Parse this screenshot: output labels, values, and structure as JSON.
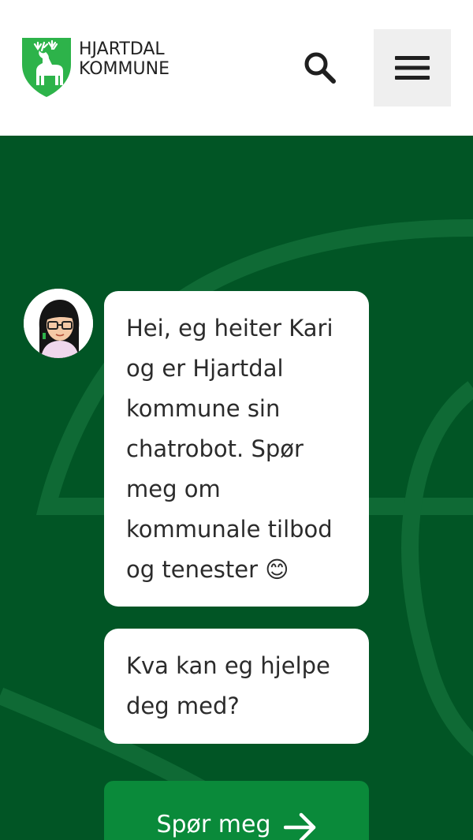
{
  "header": {
    "logo_line1": "HJARTDAL",
    "logo_line2": "KOMMUNE",
    "search_icon": "search-icon",
    "menu_icon": "hamburger-menu-icon"
  },
  "chat": {
    "avatar_icon": "chatbot-avatar",
    "messages": [
      "Hei, eg heiter Kari og er Hjartdal kommune sin chatrobot. Spør meg om kommunale tilbod og tenester 😊",
      "Kva kan eg hjelpe deg med?"
    ],
    "cta_label": "Spør meg",
    "cta_icon": "arrow-right-icon"
  },
  "colors": {
    "brand_green": "#015525",
    "button_green": "#0a8a3a",
    "shield_green": "#2db34a"
  }
}
